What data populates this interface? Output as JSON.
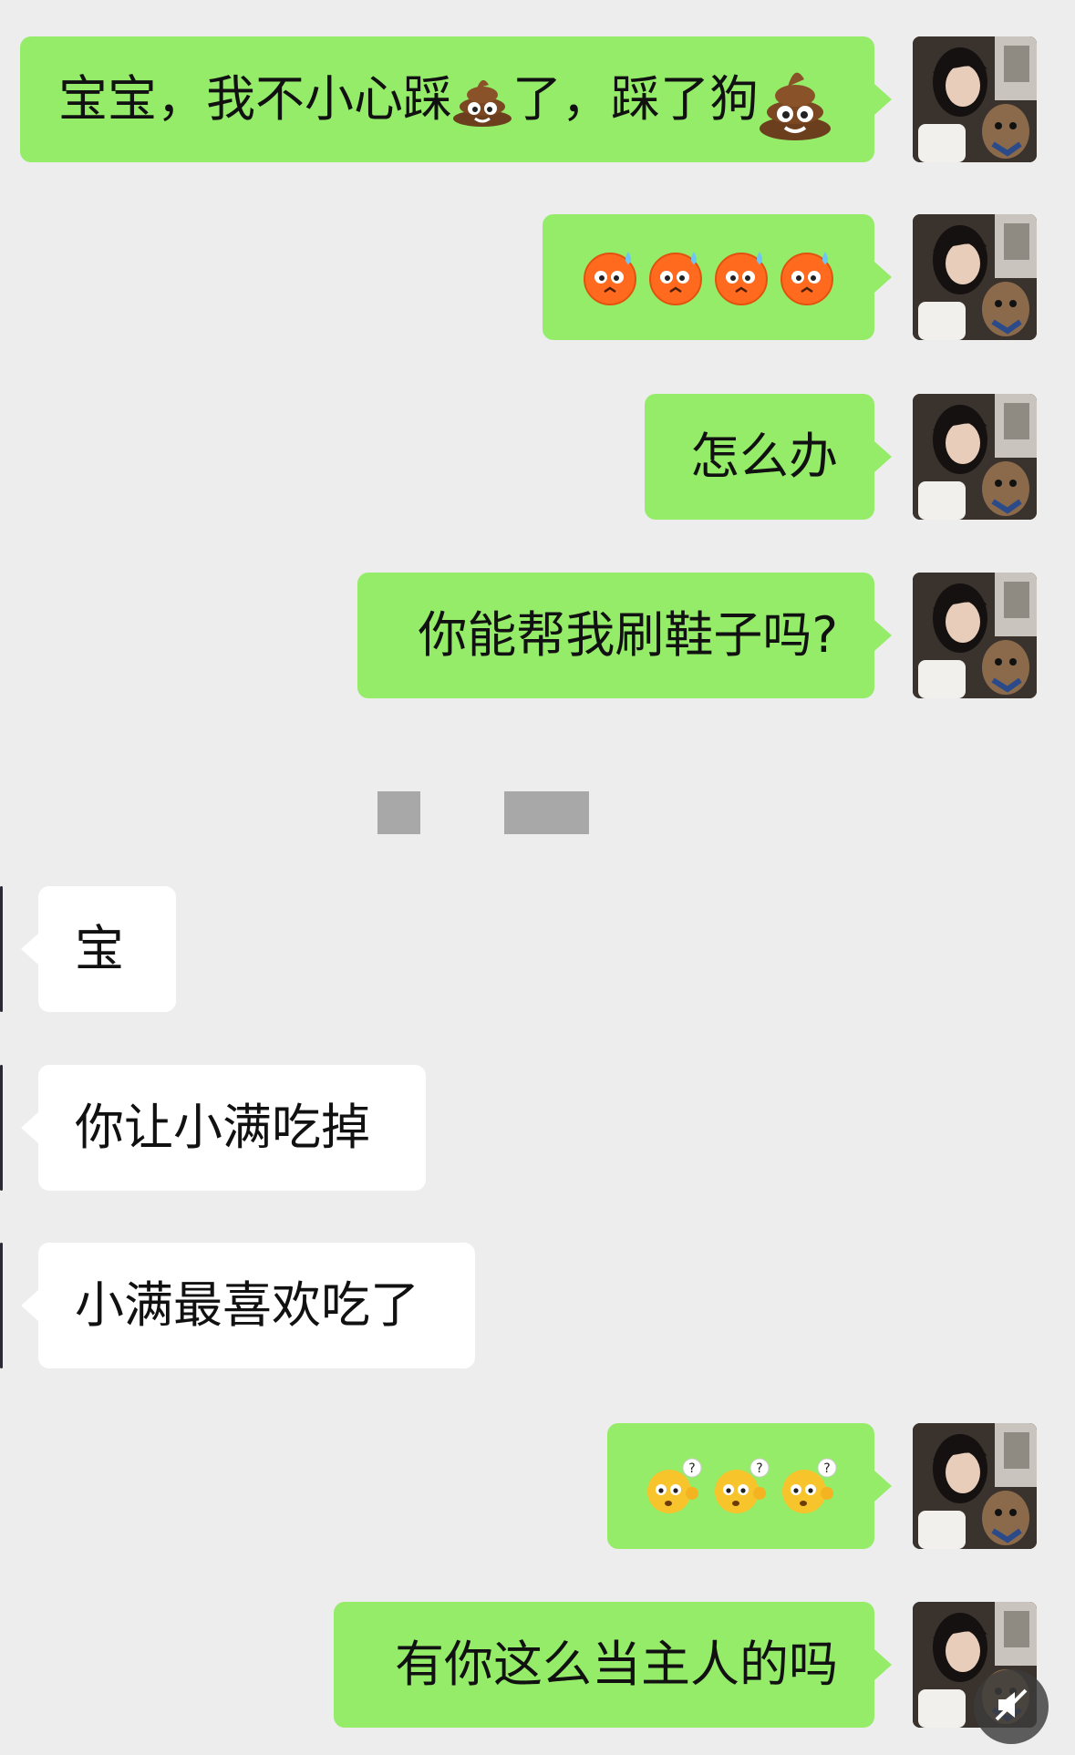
{
  "messages": [
    {
      "side": "out",
      "text": "宝宝，我不小心踩💩了，踩了狗💩"
    },
    {
      "side": "out",
      "emoji": "sweat-face",
      "count": 4
    },
    {
      "side": "out",
      "text": "怎么办"
    },
    {
      "side": "out",
      "text": "你能帮我刷鞋子吗?"
    },
    {
      "side": "in",
      "text": "宝"
    },
    {
      "side": "in",
      "text": "你让小满吃掉"
    },
    {
      "side": "in",
      "text": "小满最喜欢吃了"
    },
    {
      "side": "out",
      "emoji": "confused-face",
      "count": 3
    },
    {
      "side": "out",
      "text": "有你这么当主人的吗"
    }
  ],
  "msg1": {
    "part1": "宝宝，我不小心踩",
    "part2": "了，踩了狗"
  },
  "icons": {
    "sent_avatar": "woman-with-dog-photo",
    "sweat": "sweat-face-icon",
    "confused": "confused-face-icon",
    "poop": "poop-icon",
    "float": "mute-icon"
  },
  "colors": {
    "background": "#ededed",
    "outgoing_bubble": "#95ec69",
    "incoming_bubble": "#ffffff",
    "redaction": "#a8a8a8"
  }
}
